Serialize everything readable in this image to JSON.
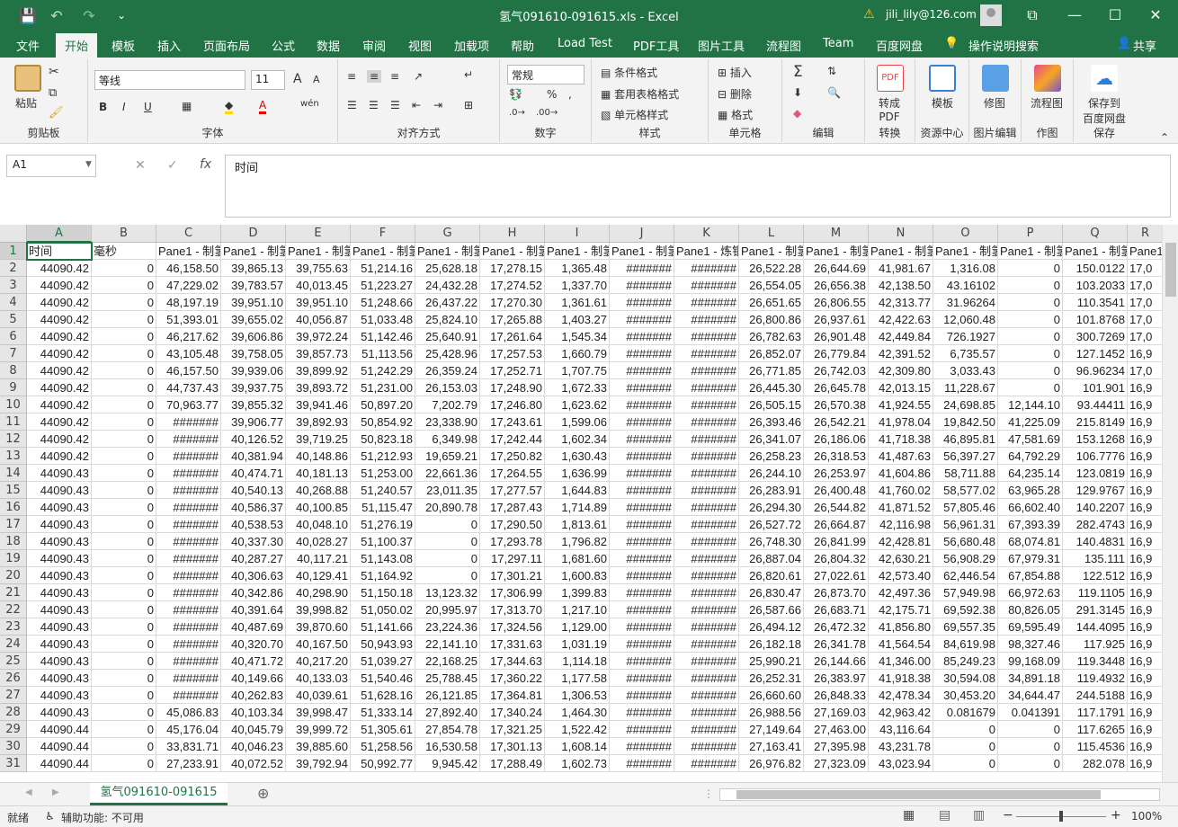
{
  "window": {
    "title": "氢气091610-091615.xls  -  Excel",
    "user": "jili_lily@126.com",
    "min": "—",
    "restore": "☐",
    "close": "✕",
    "ribbon_opts": "⧉"
  },
  "qat": {
    "save": "💾",
    "undo": "↶",
    "redo": "↷",
    "more": "⌄"
  },
  "tabs": [
    "文件",
    "开始",
    "模板",
    "插入",
    "页面布局",
    "公式",
    "数据",
    "审阅",
    "视图",
    "加载项",
    "帮助",
    "Load Test",
    "PDF工具",
    "图片工具",
    "流程图",
    "Team",
    "百度网盘"
  ],
  "tellme": "操作说明搜索",
  "share": "共享",
  "ribbon": {
    "paste": "粘贴",
    "clipboard": "剪贴板",
    "font_name": "等线",
    "font_size": "11",
    "font": "字体",
    "bold": "B",
    "italic": "I",
    "underline": "U",
    "font_grow": "A",
    "font_shrink": "A",
    "phonetic": "wén",
    "alignment": "对齐方式",
    "num_format": "常规",
    "number": "数字",
    "percent": "%",
    "comma": ",",
    "cond_format": "条件格式",
    "table_format": "套用表格格式",
    "cell_style": "单元格样式",
    "styles": "样式",
    "insert": "插入",
    "delete": "删除",
    "format": "格式",
    "cells": "单元格",
    "sum": "Σ",
    "editing": "编辑",
    "to_pdf": "转成\nPDF",
    "convert": "转换",
    "template": "模板",
    "resource": "资源中心",
    "fix_img": "修图",
    "img_edit": "图片编辑",
    "flowchart": "流程图",
    "drawing": "作图",
    "save_baidu": "保存到\n百度网盘",
    "save": "保存"
  },
  "formula": {
    "name_box": "A1",
    "content": "时间",
    "cancel": "✕",
    "enter": "✓",
    "fx": "fx"
  },
  "columns": [
    "A",
    "B",
    "C",
    "D",
    "E",
    "F",
    "G",
    "H",
    "I",
    "J",
    "K",
    "L",
    "M",
    "N",
    "O",
    "P",
    "Q",
    "R"
  ],
  "header_row": [
    "时间",
    "毫秒",
    "Pane1 - 制氢",
    "Pane1 - 制氢",
    "Pane1 - 制氢",
    "Pane1 - 制氢",
    "Pane1 - 制氢",
    "Pane1 - 制氢",
    "Pane1 - 制氢",
    "Pane1 - 制氢",
    "Pane1 - 炼钢",
    "Pane1 - 制氢",
    "Pane1 - 制氢",
    "Pane1 - 制氢",
    "Pane1 - 制氢",
    "Pane1 - 制氢",
    "Pane1 - 制氢",
    "Pane1"
  ],
  "rows": [
    [
      "44090.42",
      "0",
      "46,158.50",
      "39,865.13",
      "39,755.63",
      "51,214.16",
      "25,628.18",
      "17,278.15",
      "1,365.48",
      "#######",
      "#######",
      "26,522.28",
      "26,644.69",
      "41,981.67",
      "1,316.08",
      "0",
      "150.0122",
      "17,0"
    ],
    [
      "44090.42",
      "0",
      "47,229.02",
      "39,783.57",
      "40,013.45",
      "51,223.27",
      "24,432.28",
      "17,274.52",
      "1,337.70",
      "#######",
      "#######",
      "26,554.05",
      "26,656.38",
      "42,138.50",
      "43.16102",
      "0",
      "103.2033",
      "17,0"
    ],
    [
      "44090.42",
      "0",
      "48,197.19",
      "39,951.10",
      "39,951.10",
      "51,248.66",
      "26,437.22",
      "17,270.30",
      "1,361.61",
      "#######",
      "#######",
      "26,651.65",
      "26,806.55",
      "42,313.77",
      "31.96264",
      "0",
      "110.3541",
      "17,0"
    ],
    [
      "44090.42",
      "0",
      "51,393.01",
      "39,655.02",
      "40,056.87",
      "51,033.48",
      "25,824.10",
      "17,265.88",
      "1,403.27",
      "#######",
      "#######",
      "26,800.86",
      "26,937.61",
      "42,422.63",
      "12,060.48",
      "0",
      "101.8768",
      "17,0"
    ],
    [
      "44090.42",
      "0",
      "46,217.62",
      "39,606.86",
      "39,972.24",
      "51,142.46",
      "25,640.91",
      "17,261.64",
      "1,545.34",
      "#######",
      "#######",
      "26,782.63",
      "26,901.48",
      "42,449.84",
      "726.1927",
      "0",
      "300.7269",
      "17,0"
    ],
    [
      "44090.42",
      "0",
      "43,105.48",
      "39,758.05",
      "39,857.73",
      "51,113.56",
      "25,428.96",
      "17,257.53",
      "1,660.79",
      "#######",
      "#######",
      "26,852.07",
      "26,779.84",
      "42,391.52",
      "6,735.57",
      "0",
      "127.1452",
      "16,9"
    ],
    [
      "44090.42",
      "0",
      "46,157.50",
      "39,939.06",
      "39,899.92",
      "51,242.29",
      "26,359.24",
      "17,252.71",
      "1,707.75",
      "#######",
      "#######",
      "26,771.85",
      "26,742.03",
      "42,309.80",
      "3,033.43",
      "0",
      "96.96234",
      "17,0"
    ],
    [
      "44090.42",
      "0",
      "44,737.43",
      "39,937.75",
      "39,893.72",
      "51,231.00",
      "26,153.03",
      "17,248.90",
      "1,672.33",
      "#######",
      "#######",
      "26,445.30",
      "26,645.78",
      "42,013.15",
      "11,228.67",
      "0",
      "101.901",
      "16,9"
    ],
    [
      "44090.42",
      "0",
      "70,963.77",
      "39,855.32",
      "39,941.46",
      "50,897.20",
      "7,202.79",
      "17,246.80",
      "1,623.62",
      "#######",
      "#######",
      "26,505.15",
      "26,570.38",
      "41,924.55",
      "24,698.85",
      "12,144.10",
      "93.44411",
      "16,9"
    ],
    [
      "44090.42",
      "0",
      "#######",
      "39,906.77",
      "39,892.93",
      "50,854.92",
      "23,338.90",
      "17,243.61",
      "1,599.06",
      "#######",
      "#######",
      "26,393.46",
      "26,542.21",
      "41,978.04",
      "19,842.50",
      "41,225.09",
      "215.8149",
      "16,9"
    ],
    [
      "44090.42",
      "0",
      "#######",
      "40,126.52",
      "39,719.25",
      "50,823.18",
      "6,349.98",
      "17,242.44",
      "1,602.34",
      "#######",
      "#######",
      "26,341.07",
      "26,186.06",
      "41,718.38",
      "46,895.81",
      "47,581.69",
      "153.1268",
      "16,9"
    ],
    [
      "44090.42",
      "0",
      "#######",
      "40,381.94",
      "40,148.86",
      "51,212.93",
      "19,659.21",
      "17,250.82",
      "1,630.43",
      "#######",
      "#######",
      "26,258.23",
      "26,318.53",
      "41,487.63",
      "56,397.27",
      "64,792.29",
      "106.7776",
      "16,9"
    ],
    [
      "44090.43",
      "0",
      "#######",
      "40,474.71",
      "40,181.13",
      "51,253.00",
      "22,661.36",
      "17,264.55",
      "1,636.99",
      "#######",
      "#######",
      "26,244.10",
      "26,253.97",
      "41,604.86",
      "58,711.88",
      "64,235.14",
      "123.0819",
      "16,9"
    ],
    [
      "44090.43",
      "0",
      "#######",
      "40,540.13",
      "40,268.88",
      "51,240.57",
      "23,011.35",
      "17,277.57",
      "1,644.83",
      "#######",
      "#######",
      "26,283.91",
      "26,400.48",
      "41,760.02",
      "58,577.02",
      "63,965.28",
      "129.9767",
      "16,9"
    ],
    [
      "44090.43",
      "0",
      "#######",
      "40,586.37",
      "40,100.85",
      "51,115.47",
      "20,890.78",
      "17,287.43",
      "1,714.89",
      "#######",
      "#######",
      "26,294.30",
      "26,544.82",
      "41,871.52",
      "57,805.46",
      "66,602.40",
      "140.2207",
      "16,9"
    ],
    [
      "44090.43",
      "0",
      "#######",
      "40,538.53",
      "40,048.10",
      "51,276.19",
      "0",
      "17,290.50",
      "1,813.61",
      "#######",
      "#######",
      "26,527.72",
      "26,664.87",
      "42,116.98",
      "56,961.31",
      "67,393.39",
      "282.4743",
      "16,9"
    ],
    [
      "44090.43",
      "0",
      "#######",
      "40,337.30",
      "40,028.27",
      "51,100.37",
      "0",
      "17,293.78",
      "1,796.82",
      "#######",
      "#######",
      "26,748.30",
      "26,841.99",
      "42,428.81",
      "56,680.48",
      "68,074.81",
      "140.4831",
      "16,9"
    ],
    [
      "44090.43",
      "0",
      "#######",
      "40,287.27",
      "40,117.21",
      "51,143.08",
      "0",
      "17,297.11",
      "1,681.60",
      "#######",
      "#######",
      "26,887.04",
      "26,804.32",
      "42,630.21",
      "56,908.29",
      "67,979.31",
      "135.111",
      "16,9"
    ],
    [
      "44090.43",
      "0",
      "#######",
      "40,306.63",
      "40,129.41",
      "51,164.92",
      "0",
      "17,301.21",
      "1,600.83",
      "#######",
      "#######",
      "26,820.61",
      "27,022.61",
      "42,573.40",
      "62,446.54",
      "67,854.88",
      "122.512",
      "16,9"
    ],
    [
      "44090.43",
      "0",
      "#######",
      "40,342.86",
      "40,298.90",
      "51,150.18",
      "13,123.32",
      "17,306.99",
      "1,399.83",
      "#######",
      "#######",
      "26,830.47",
      "26,873.70",
      "42,497.36",
      "57,949.98",
      "66,972.63",
      "119.1105",
      "16,9"
    ],
    [
      "44090.43",
      "0",
      "#######",
      "40,391.64",
      "39,998.82",
      "51,050.02",
      "20,995.97",
      "17,313.70",
      "1,217.10",
      "#######",
      "#######",
      "26,587.66",
      "26,683.71",
      "42,175.71",
      "69,592.38",
      "80,826.05",
      "291.3145",
      "16,9"
    ],
    [
      "44090.43",
      "0",
      "#######",
      "40,487.69",
      "39,870.60",
      "51,141.66",
      "23,224.36",
      "17,324.56",
      "1,129.00",
      "#######",
      "#######",
      "26,494.12",
      "26,472.32",
      "41,856.80",
      "69,557.35",
      "69,595.49",
      "144.4095",
      "16,9"
    ],
    [
      "44090.43",
      "0",
      "#######",
      "40,320.70",
      "40,167.50",
      "50,943.93",
      "22,141.10",
      "17,331.63",
      "1,031.19",
      "#######",
      "#######",
      "26,182.18",
      "26,341.78",
      "41,564.54",
      "84,619.98",
      "98,327.46",
      "117.925",
      "16,9"
    ],
    [
      "44090.43",
      "0",
      "#######",
      "40,471.72",
      "40,217.20",
      "51,039.27",
      "22,168.25",
      "17,344.63",
      "1,114.18",
      "#######",
      "#######",
      "25,990.21",
      "26,144.66",
      "41,346.00",
      "85,249.23",
      "99,168.09",
      "119.3448",
      "16,9"
    ],
    [
      "44090.43",
      "0",
      "#######",
      "40,149.66",
      "40,133.03",
      "51,540.46",
      "25,788.45",
      "17,360.22",
      "1,177.58",
      "#######",
      "#######",
      "26,252.31",
      "26,383.97",
      "41,918.38",
      "30,594.08",
      "34,891.18",
      "119.4932",
      "16,9"
    ],
    [
      "44090.43",
      "0",
      "#######",
      "40,262.83",
      "40,039.61",
      "51,628.16",
      "26,121.85",
      "17,364.81",
      "1,306.53",
      "#######",
      "#######",
      "26,660.60",
      "26,848.33",
      "42,478.34",
      "30,453.20",
      "34,644.47",
      "244.5188",
      "16,9"
    ],
    [
      "44090.43",
      "0",
      "45,086.83",
      "40,103.34",
      "39,998.47",
      "51,333.14",
      "27,892.40",
      "17,340.24",
      "1,464.30",
      "#######",
      "#######",
      "26,988.56",
      "27,169.03",
      "42,963.42",
      "0.081679",
      "0.041391",
      "117.1791",
      "16,9"
    ],
    [
      "44090.44",
      "0",
      "45,176.04",
      "40,045.79",
      "39,999.72",
      "51,305.61",
      "27,854.78",
      "17,321.25",
      "1,522.42",
      "#######",
      "#######",
      "27,149.64",
      "27,463.00",
      "43,116.64",
      "0",
      "0",
      "117.6265",
      "16,9"
    ],
    [
      "44090.44",
      "0",
      "33,831.71",
      "40,046.23",
      "39,885.60",
      "51,258.56",
      "16,530.58",
      "17,301.13",
      "1,608.14",
      "#######",
      "#######",
      "27,163.41",
      "27,395.98",
      "43,231.78",
      "0",
      "0",
      "115.4536",
      "16,9"
    ],
    [
      "44090.44",
      "0",
      "27,233.91",
      "40,072.52",
      "39,792.94",
      "50,992.77",
      "9,945.42",
      "17,288.49",
      "1,602.73",
      "#######",
      "#######",
      "26,976.82",
      "27,323.09",
      "43,023.94",
      "0",
      "0",
      "282.078",
      "16,9"
    ]
  ],
  "sheet_tab": "氢气091610-091615",
  "status": {
    "ready": "就绪",
    "access": "辅助功能: 不可用",
    "zoom": "100%"
  }
}
